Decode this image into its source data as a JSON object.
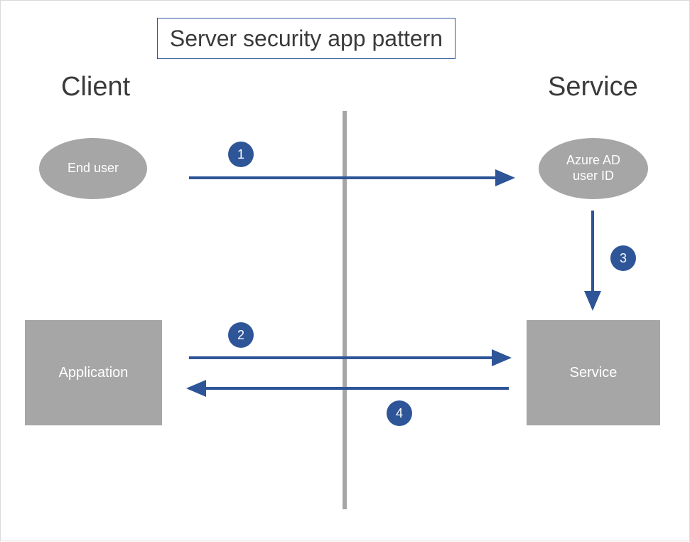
{
  "title": "Server security app pattern",
  "sections": {
    "left": "Client",
    "right": "Service"
  },
  "nodes": {
    "end_user": "End user",
    "azure_ad": "Azure AD\nuser ID",
    "application": "Application",
    "service": "Service"
  },
  "steps": {
    "s1": "1",
    "s2": "2",
    "s3": "3",
    "s4": "4"
  },
  "colors": {
    "accent": "#2e5597",
    "node_fill": "#a6a6a6",
    "divider": "#a6a6a6",
    "text": "#3a3a3a"
  }
}
